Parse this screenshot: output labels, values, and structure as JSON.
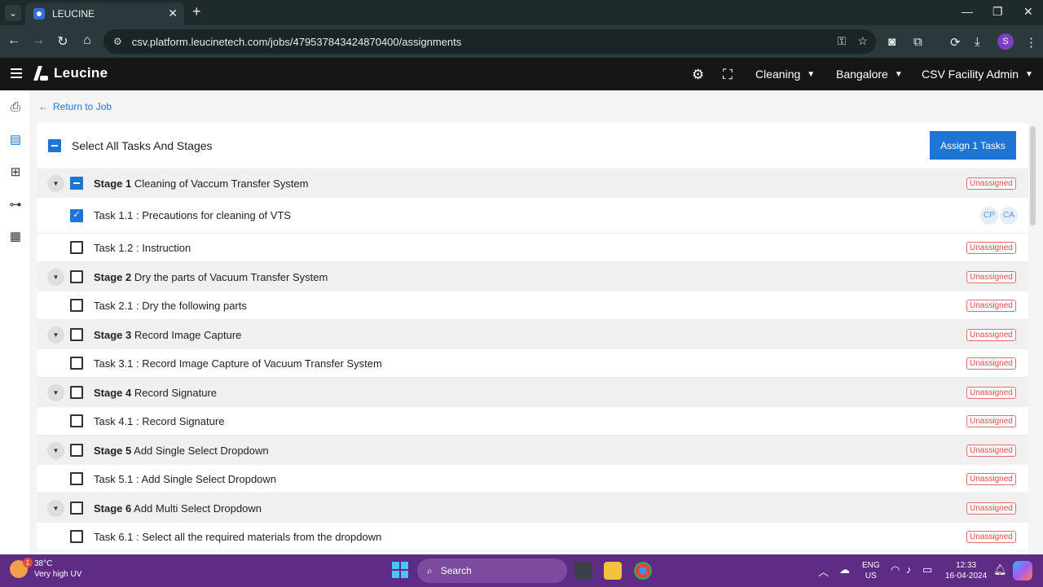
{
  "browser": {
    "tab_title": "LEUCINE",
    "url": "csv.platform.leucinetech.com/jobs/479537843424870400/assignments",
    "profile_initial": "S"
  },
  "header": {
    "brand": "Leucine",
    "use_case": "Cleaning",
    "facility": "Bangalore",
    "role": "CSV Facility Admin"
  },
  "nav": {
    "back_label": "Return to Job"
  },
  "assignment": {
    "select_all_label": "Select All Tasks And Stages",
    "assign_button": "Assign 1 Tasks",
    "unassigned_label": "Unassigned",
    "assignees": [
      "CP",
      "CA"
    ],
    "rows": [
      {
        "kind": "stage",
        "prefix": "Stage 1",
        "name": "Cleaning of Vaccum Transfer System",
        "state": "indeterminate",
        "status": "Unassigned"
      },
      {
        "kind": "task",
        "prefix": "",
        "name": "Task 1.1 : Precautions for cleaning of VTS",
        "state": "checked",
        "status": "assigned"
      },
      {
        "kind": "task",
        "prefix": "",
        "name": "Task 1.2 : Instruction",
        "state": "unchecked",
        "status": "Unassigned"
      },
      {
        "kind": "stage",
        "prefix": "Stage 2",
        "name": "Dry the parts of Vacuum Transfer System",
        "state": "unchecked",
        "status": "Unassigned"
      },
      {
        "kind": "task",
        "prefix": "",
        "name": "Task 2.1 : Dry the following parts",
        "state": "unchecked",
        "status": "Unassigned"
      },
      {
        "kind": "stage",
        "prefix": "Stage 3",
        "name": "Record Image Capture",
        "state": "unchecked",
        "status": "Unassigned"
      },
      {
        "kind": "task",
        "prefix": "",
        "name": "Task 3.1 : Record Image Capture of Vacuum Transfer System",
        "state": "unchecked",
        "status": "Unassigned"
      },
      {
        "kind": "stage",
        "prefix": "Stage 4",
        "name": "Record Signature",
        "state": "unchecked",
        "status": "Unassigned"
      },
      {
        "kind": "task",
        "prefix": "",
        "name": "Task 4.1 : Record Signature",
        "state": "unchecked",
        "status": "Unassigned"
      },
      {
        "kind": "stage",
        "prefix": "Stage 5",
        "name": "Add Single Select Dropdown",
        "state": "unchecked",
        "status": "Unassigned"
      },
      {
        "kind": "task",
        "prefix": "",
        "name": "Task 5.1 : Add Single Select Dropdown",
        "state": "unchecked",
        "status": "Unassigned"
      },
      {
        "kind": "stage",
        "prefix": "Stage 6",
        "name": "Add Multi Select Dropdown",
        "state": "unchecked",
        "status": "Unassigned"
      },
      {
        "kind": "task",
        "prefix": "",
        "name": "Task 6.1 : Select all the required materials from the dropdown",
        "state": "unchecked",
        "status": "Unassigned"
      }
    ]
  },
  "taskbar": {
    "weather_temp": "38°C",
    "weather_desc": "Very high UV",
    "weather_badge": "1",
    "search_placeholder": "Search",
    "lang_top": "ENG",
    "lang_bottom": "US",
    "time": "12:33",
    "date": "16-04-2024"
  },
  "colors": {
    "accent": "#1d76d6",
    "header_bg": "#161616",
    "unassigned": "#d94b4b",
    "taskbar": "#5e2c84"
  }
}
